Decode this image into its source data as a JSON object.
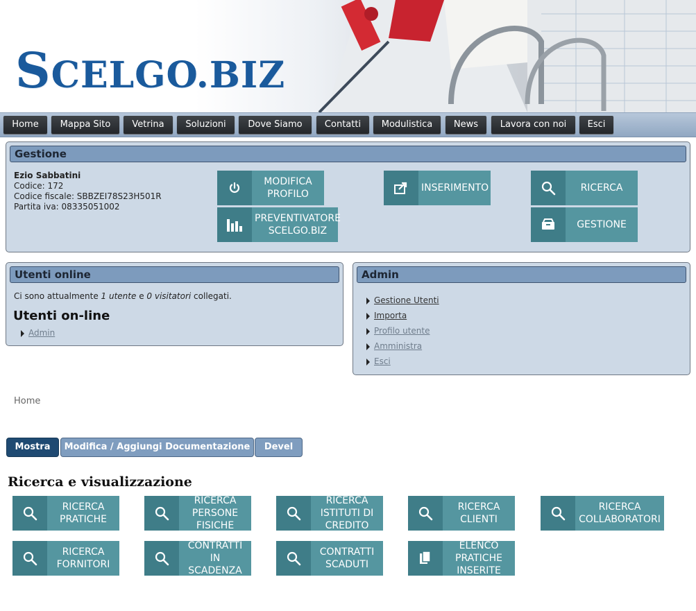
{
  "header": {
    "logo": "SCELGO.BIZ",
    "logo_parts": [
      "S",
      "CELGO.",
      "BIZ"
    ]
  },
  "nav": [
    "Home",
    "Mappa Sito",
    "Vetrina",
    "Soluzioni",
    "Dove Siamo",
    "Contatti",
    "Modulistica",
    "News",
    "Lavora con noi",
    "Esci"
  ],
  "gestione": {
    "title": "Gestione",
    "user": {
      "name": "Ezio Sabbatini",
      "codice": "Codice: 172",
      "codice_fiscale": "Codice fiscale: SBBZEI78S23H501R",
      "partita_iva": "Partita iva: 08335051002"
    },
    "buttons": {
      "modifica_profilo": [
        "MODIFICA",
        "PROFILO"
      ],
      "preventivatore": [
        "PREVENTIVATORE",
        "SCELGO.BIZ"
      ],
      "inserimento": [
        "INSERIMENTO"
      ],
      "ricerca": [
        "RICERCA"
      ],
      "gestione": [
        "GESTIONE"
      ]
    }
  },
  "utenti_online": {
    "title": "Utenti online",
    "text_prefix": "Ci sono attualmente ",
    "utenti": "1 utente",
    "text_mid": " e ",
    "visitatori": "0 visitatori",
    "text_suffix": " collegati.",
    "heading": "Utenti on-line",
    "list": [
      "Admin"
    ]
  },
  "admin": {
    "title": "Admin",
    "links": [
      "Gestione Utenti",
      "Importa",
      "Profilo utente",
      "Amministra",
      "Esci"
    ]
  },
  "breadcrumb": "Home",
  "tabs": [
    "Mostra",
    "Modifica / Aggiungi Documentazione",
    "Devel"
  ],
  "section_title": "Ricerca e visualizzazione",
  "search_tiles": [
    {
      "lines": [
        "RICERCA",
        "PRATICHE"
      ],
      "icon": "search-icon"
    },
    {
      "lines": [
        "RICERCA",
        "PERSONE",
        "FISICHE"
      ],
      "icon": "search-icon"
    },
    {
      "lines": [
        "RICERCA",
        "ISTITUTI DI",
        "CREDITO"
      ],
      "icon": "search-icon"
    },
    {
      "lines": [
        "RICERCA",
        "CLIENTI"
      ],
      "icon": "search-icon"
    },
    {
      "lines": [
        "RICERCA",
        "COLLABORATORI"
      ],
      "icon": "search-icon"
    },
    {
      "lines": [
        "RICERCA",
        "FORNITORI"
      ],
      "icon": "search-icon"
    },
    {
      "lines": [
        "CONTRATTI IN",
        "SCADENZA"
      ],
      "icon": "search-icon"
    },
    {
      "lines": [
        "CONTRATTI",
        "SCADUTI"
      ],
      "icon": "search-icon"
    },
    {
      "lines": [
        "ELENCO",
        "PRATICHE",
        "INSERITE"
      ],
      "icon": "document-icon"
    }
  ],
  "colors": {
    "tile": "#5596a0",
    "tile_icon": "#3f7d88",
    "panel": "#cdd9e6",
    "title_bar": "#7d9bbd",
    "logo": "#1a5a9c"
  }
}
